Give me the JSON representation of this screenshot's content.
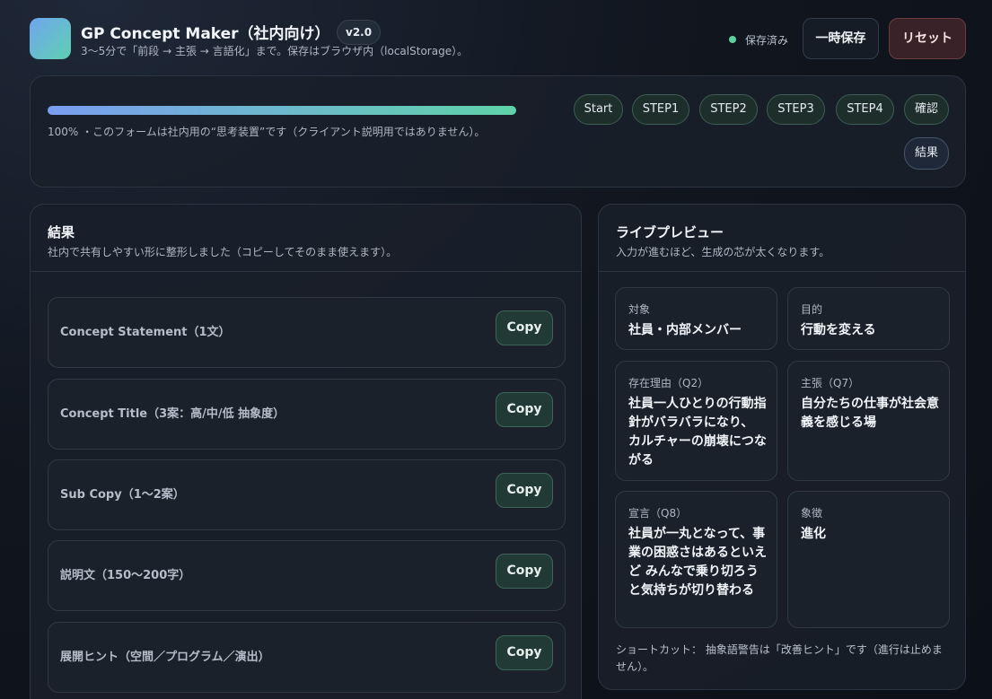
{
  "header": {
    "title": "GP Concept Maker（社内向け）",
    "version": "v2.0",
    "subtitle": "3〜5分で「前段 → 主張 → 言語化」まで。保存はブラウザ内（localStorage）。",
    "save_status": "保存済み",
    "save_button": "一時保存",
    "reset_button": "リセット",
    "colors": {
      "save_dot": "#5fd0a0",
      "reset_accent": "#6a3a40"
    }
  },
  "progress": {
    "percent": 100,
    "note": "100% ・このフォームは社内用の“思考装置”です（クライアント説明用ではありません）。",
    "steps": [
      "Start",
      "STEP1",
      "STEP2",
      "STEP3",
      "STEP4",
      "確認",
      "結果"
    ],
    "active_step": "結果"
  },
  "result": {
    "title": "結果",
    "subtitle": "社内で共有しやすい形に整形しました（コピーしてそのまま使えます）。",
    "copy_label": "Copy",
    "items": [
      {
        "label": "Concept Statement（1文）"
      },
      {
        "label": "Concept Title（3案：高/中/低 抽象度）"
      },
      {
        "label": "Sub Copy（1〜2案）"
      },
      {
        "label": "説明文（150〜200字）"
      },
      {
        "label": "展開ヒント（空間／プログラム／演出）"
      }
    ]
  },
  "preview": {
    "title": "ライブプレビュー",
    "subtitle": "入力が進むほど、生成の芯が太くなります。",
    "tiles": [
      {
        "label": "対象",
        "value": "社員・内部メンバー"
      },
      {
        "label": "目的",
        "value": "行動を変える"
      },
      {
        "label": "存在理由（Q2）",
        "value": "社員一人ひとりの行動指針がバラバラになり、 カルチャーの崩壊につながる"
      },
      {
        "label": "主張（Q7）",
        "value": "自分たちの仕事が社会意義を感じる場"
      },
      {
        "label": "宣言（Q8）",
        "value": "社員が一丸となって、事業の困惑さはあるといえど みんなで乗り切ろうと気持ちが切り替わる"
      },
      {
        "label": "象徴",
        "value": "進化"
      }
    ],
    "shortcut_note": "ショートカット： 抽象語警告は「改善ヒント」です（進行は止めません）。"
  }
}
